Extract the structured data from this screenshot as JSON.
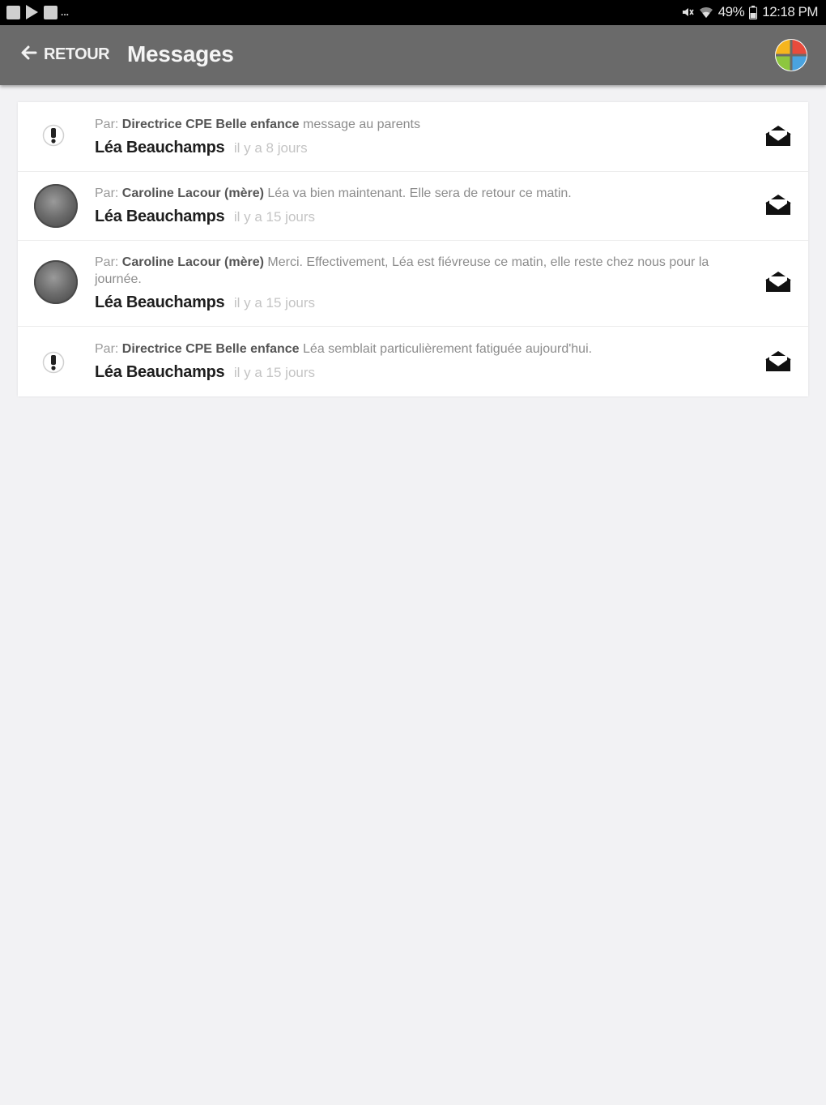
{
  "status_bar": {
    "battery_level": "49%",
    "time": "12:18 PM",
    "left_icons": [
      "gallery-icon",
      "play-store-icon",
      "calendar-icon"
    ],
    "overflow": "..."
  },
  "app_bar": {
    "back_label": "RETOUR",
    "title": "Messages",
    "logo_colors": [
      "#e94b3c",
      "#4aa3df",
      "#8dc63f",
      "#f6b51d"
    ]
  },
  "messages": [
    {
      "from_prefix": "Par:",
      "sender": "Directrice CPE Belle enfance",
      "body": "message au parents",
      "child": "Léa Beauchamps",
      "time": "il y a 8 jours",
      "sender_icon": "alert-icon"
    },
    {
      "from_prefix": "Par:",
      "sender": "Caroline Lacour (mère)",
      "body": "Léa va bien maintenant. Elle sera de retour ce matin.",
      "child": "Léa Beauchamps",
      "time": "il y a 15 jours",
      "sender_icon": "avatar"
    },
    {
      "from_prefix": "Par:",
      "sender": "Caroline Lacour (mère)",
      "body": "Merci. Effectivement, Léa est fiévreuse ce matin, elle reste chez nous pour la journée.",
      "child": "Léa Beauchamps",
      "time": "il y a 15 jours",
      "sender_icon": "avatar"
    },
    {
      "from_prefix": "Par:",
      "sender": "Directrice CPE Belle enfance",
      "body": "Léa semblait particulièrement fatiguée aujourd'hui.",
      "child": "Léa Beauchamps",
      "time": "il y a 15 jours",
      "sender_icon": "alert-icon"
    }
  ]
}
